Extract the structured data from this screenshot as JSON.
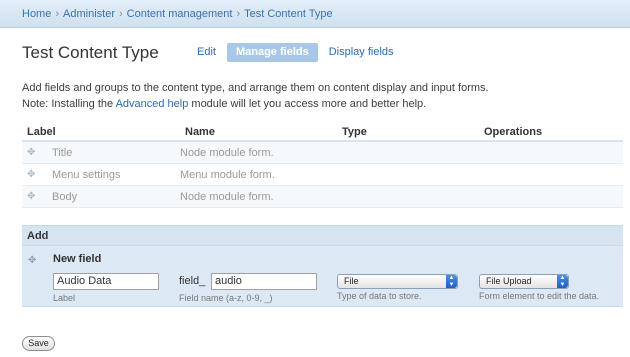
{
  "breadcrumb": {
    "items": [
      "Home",
      "Administer",
      "Content management",
      "Test Content Type"
    ],
    "separator": "›"
  },
  "page": {
    "title": "Test Content Type",
    "tabs": [
      {
        "label": "Edit",
        "active": false
      },
      {
        "label": "Manage fields",
        "active": true
      },
      {
        "label": "Display fields",
        "active": false
      }
    ]
  },
  "help": {
    "line1": "Add fields and groups to the content type, and arrange them on content display and input forms.",
    "line2_before": "Note: Installing the ",
    "line2_link": "Advanced help",
    "line2_after": " module will let you access more and better help."
  },
  "table": {
    "headers": [
      "Label",
      "Name",
      "Type",
      "Operations"
    ],
    "rows": [
      {
        "label": "Title",
        "name": "Node module form."
      },
      {
        "label": "Menu settings",
        "name": "Menu module form."
      },
      {
        "label": "Body",
        "name": "Node module form."
      }
    ]
  },
  "add": {
    "header": "Add",
    "new_field_label": "New field",
    "label_value": "Audio Data",
    "label_hint": "Label",
    "name_prefix": "field_",
    "name_value": "audio",
    "name_hint": "Field name (a-z, 0-9, _)",
    "type_value": "File",
    "type_hint": "Type of data to store.",
    "widget_value": "File Upload",
    "widget_hint": "Form element to edit the data."
  },
  "save_label": "Save",
  "colors": {
    "link": "#2a6bb0",
    "tab_active": "#a9c8e7",
    "add_bg": "#dce8f4",
    "select_arrow": "#1f5fc4"
  }
}
